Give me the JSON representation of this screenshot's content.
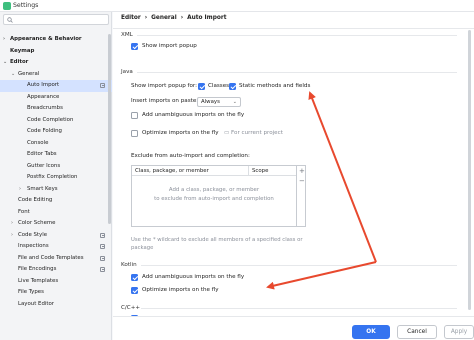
{
  "window": {
    "title": "Settings"
  },
  "colors": {
    "accent": "#3574f0",
    "selection": "#d4e2ff",
    "annotation_arrow": "#e8492e"
  },
  "sidebar": {
    "items": [
      {
        "label": "Appearance & Behavior",
        "expanded": false,
        "bold": true
      },
      {
        "label": "Keymap",
        "bold": true
      },
      {
        "label": "Editor",
        "expanded": true,
        "bold": true
      },
      {
        "label": "General",
        "expanded": true
      },
      {
        "label": "Auto Import",
        "selected": true,
        "icon": "copy-icon"
      },
      {
        "label": "Appearance"
      },
      {
        "label": "Breadcrumbs"
      },
      {
        "label": "Code Completion"
      },
      {
        "label": "Code Folding"
      },
      {
        "label": "Console"
      },
      {
        "label": "Editor Tabs"
      },
      {
        "label": "Gutter Icons"
      },
      {
        "label": "Postfix Completion"
      },
      {
        "label": "Smart Keys",
        "expanded": false
      },
      {
        "label": "Code Editing"
      },
      {
        "label": "Font"
      },
      {
        "label": "Color Scheme",
        "expanded": false
      },
      {
        "label": "Code Style",
        "expanded": false,
        "icon": "copy-icon"
      },
      {
        "label": "Inspections",
        "icon": "copy-icon"
      },
      {
        "label": "File and Code Templates",
        "icon": "copy-icon"
      },
      {
        "label": "File Encodings",
        "icon": "copy-icon"
      },
      {
        "label": "Live Templates"
      },
      {
        "label": "File Types"
      },
      {
        "label": "Layout Editor"
      }
    ]
  },
  "breadcrumb": {
    "part1": "Editor",
    "sep1": "›",
    "part2": "General",
    "sep2": "›",
    "part3": "Auto Import"
  },
  "xml": {
    "section_label": "XML",
    "show_import_popup": {
      "label": "Show import popup",
      "checked": true
    }
  },
  "java": {
    "section_label": "Java",
    "show_popup_for_label": "Show import popup for:",
    "classes": {
      "label": "Classes",
      "checked": true
    },
    "static_methods": {
      "label": "Static methods and fields",
      "checked": true
    },
    "insert_on_paste_label": "Insert imports on paste:",
    "insert_on_paste_value": "Always",
    "add_unambiguous": {
      "label": "Add unambiguous imports on the fly",
      "checked": false
    },
    "optimize": {
      "label": "Optimize imports on the fly",
      "checked": false,
      "hint": "For current project"
    },
    "exclude_label": "Exclude from auto-import and completion:",
    "table": {
      "columns": [
        "Class, package, or member",
        "Scope"
      ],
      "empty_line1": "Add a class, package, or member",
      "empty_line2": "to exclude from auto-import and completion"
    },
    "note_line1": "Use the * wildcard to exclude all members of a specified class or",
    "note_line2": "package"
  },
  "kotlin": {
    "section_label": "Kotlin",
    "add_unambiguous": {
      "label": "Add unambiguous imports on the fly",
      "checked": true
    },
    "optimize": {
      "label": "Optimize imports on the fly",
      "checked": true
    }
  },
  "cpp": {
    "section_label": "C/C++"
  },
  "buttons": {
    "ok": "OK",
    "cancel": "Cancel",
    "apply": "Apply"
  }
}
